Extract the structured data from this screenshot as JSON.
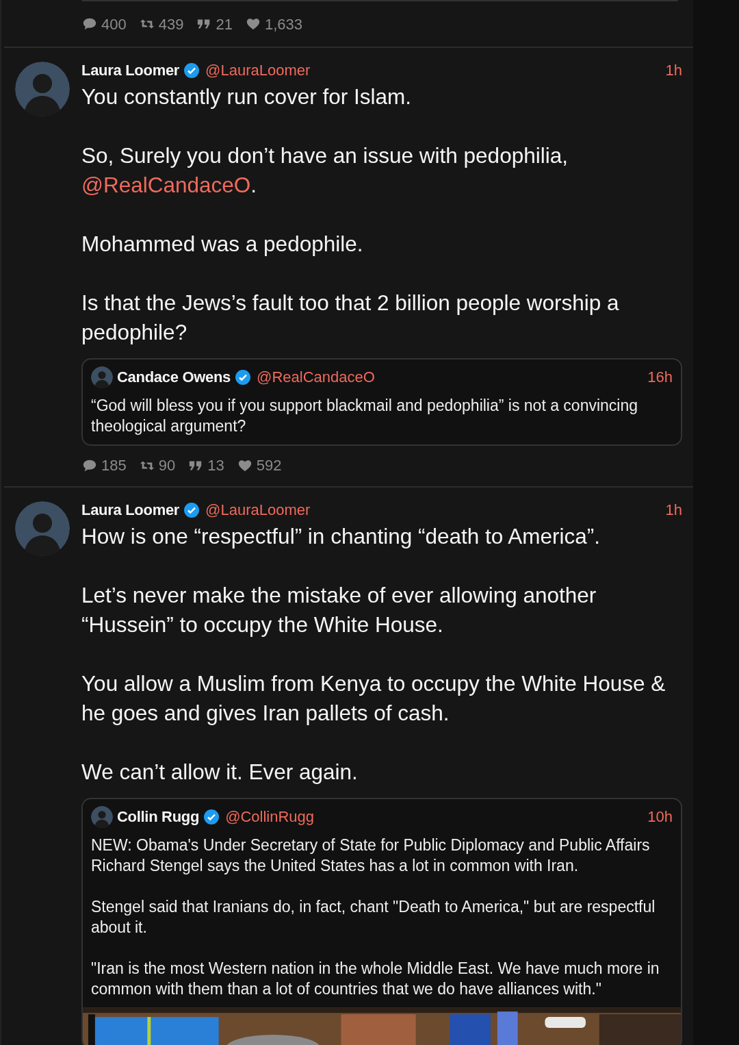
{
  "top_stats": {
    "replies": "400",
    "retweets": "439",
    "quotes": "21",
    "likes": "1,633"
  },
  "tweets": [
    {
      "author": "Laura Loomer",
      "verified": true,
      "handle": "@LauraLoomer",
      "time": "1h",
      "paragraphs": [
        [
          {
            "kind": "plain",
            "text": "You constantly run cover for Islam."
          }
        ],
        [
          {
            "kind": "plain",
            "text": "So, Surely you don’t have an issue with pedophilia, "
          },
          {
            "kind": "mention",
            "text": "@RealCandaceO"
          },
          {
            "kind": "plain",
            "text": "."
          }
        ],
        [
          {
            "kind": "plain",
            "text": "Mohammed was a pedophile."
          }
        ],
        [
          {
            "kind": "plain",
            "text": "Is that the Jews’s fault too that 2 billion people worship a pedophile?"
          }
        ]
      ],
      "quote": {
        "author": "Candace Owens",
        "verified": true,
        "handle": "@RealCandaceO",
        "time": "16h",
        "paragraphs": [
          "“God will bless you if you support blackmail and pedophilia” is not a convincing theological argument?"
        ]
      },
      "stats": {
        "replies": "185",
        "retweets": "90",
        "quotes": "13",
        "likes": "592"
      }
    },
    {
      "author": "Laura Loomer",
      "verified": true,
      "handle": "@LauraLoomer",
      "time": "1h",
      "paragraphs": [
        [
          {
            "kind": "plain",
            "text": "How is one “respectful” in chanting “death to America”."
          }
        ],
        [
          {
            "kind": "plain",
            "text": "Let’s never make the mistake of ever allowing another “Hussein” to occupy the White House."
          }
        ],
        [
          {
            "kind": "plain",
            "text": "You allow a Muslim from Kenya to occupy the White House & he goes and gives Iran pallets of cash."
          }
        ],
        [
          {
            "kind": "plain",
            "text": "We can’t allow it. Ever again."
          }
        ]
      ],
      "quote": {
        "author": "Collin Rugg",
        "verified": true,
        "handle": "@CollinRugg",
        "time": "10h",
        "paragraphs": [
          "NEW: Obama's Under Secretary of State for Public Diplomacy and Public Affairs Richard Stengel says the United States has a lot in common with Iran.",
          "Stengel said that Iranians do, in fact, chant \"Death to America,\" but are respectful about it.",
          "\"Iran is the most Western nation in the whole Middle East. We have much more in common with them than a lot of countries that we do have alliances with.\""
        ],
        "media": {
          "kind": "picture"
        }
      }
    }
  ]
}
